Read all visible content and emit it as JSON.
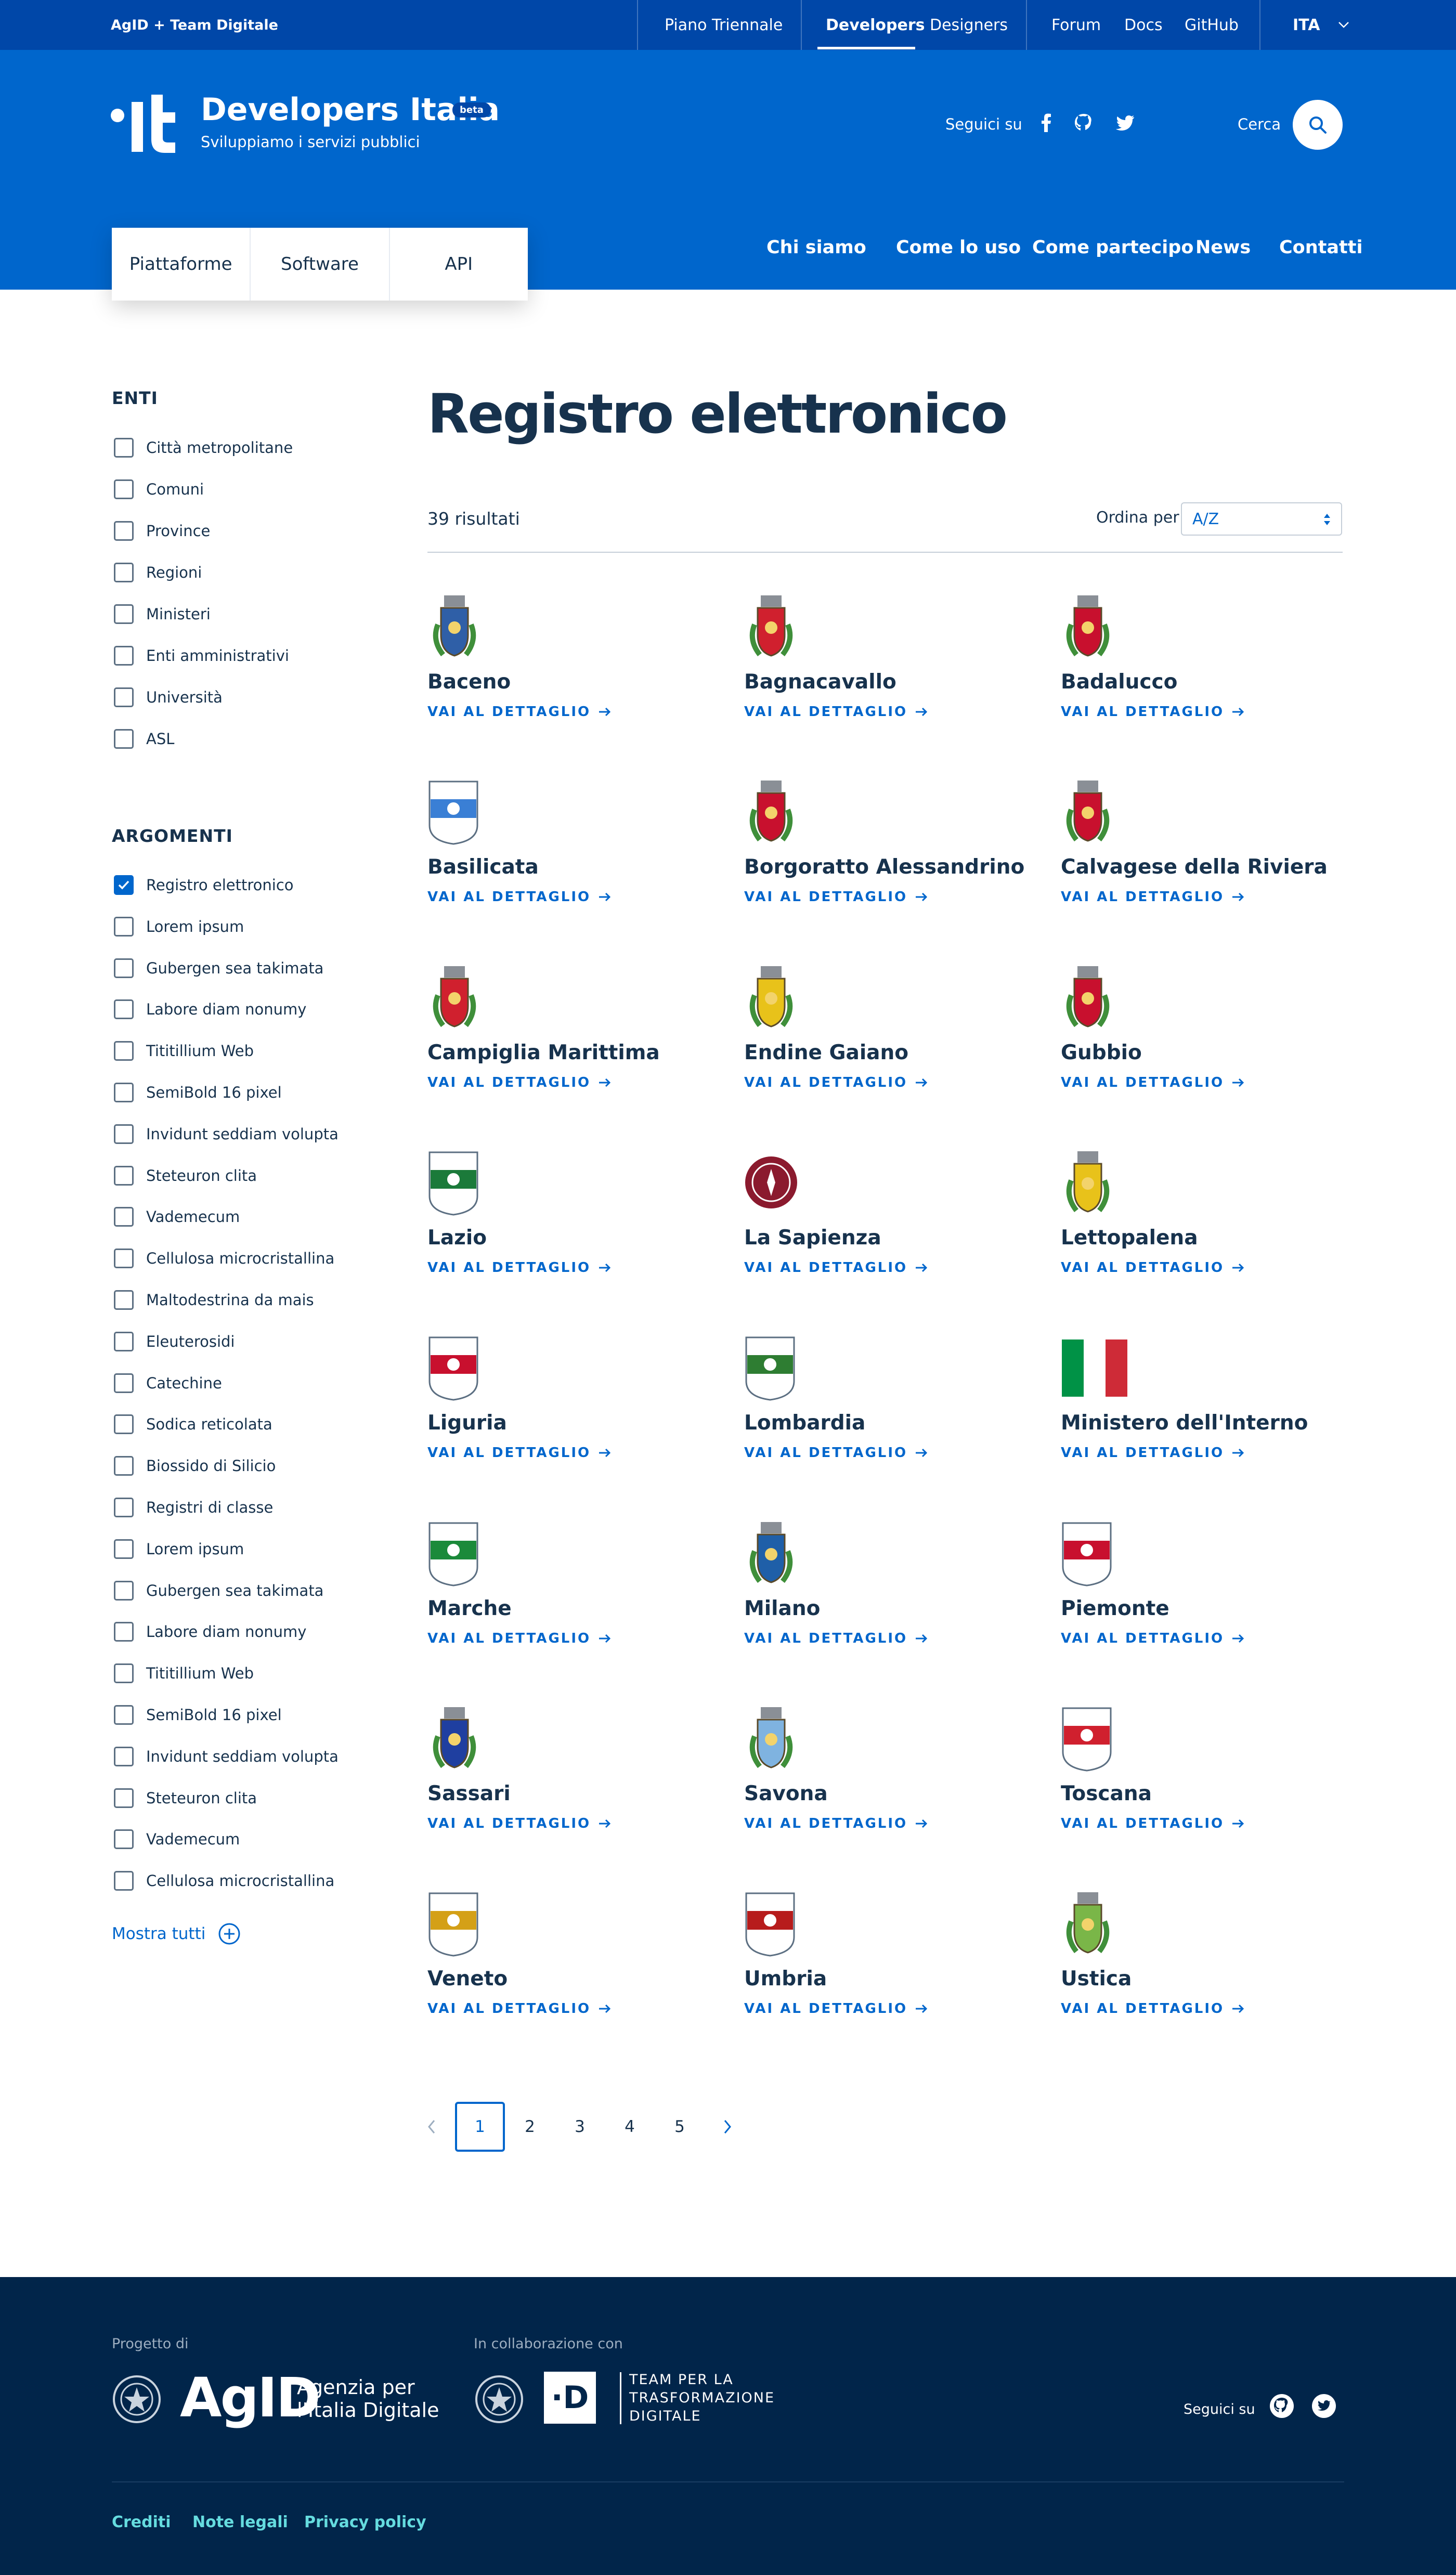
{
  "topbar": {
    "brand": "AgID  +  Team Digitale",
    "links": [
      "Piano Triennale",
      "Developers",
      "Designers",
      "Forum",
      "Docs",
      "GitHub"
    ],
    "lang": "ITA"
  },
  "header": {
    "title": "Developers Italia",
    "beta": "beta",
    "tagline": "Sviluppiamo i servizi pubblici",
    "follow": "Seguici su",
    "search": "Cerca",
    "tabs": [
      "Piattaforme",
      "Software",
      "API"
    ],
    "nav": [
      "Chi siamo",
      "Come lo uso",
      "Come partecipo",
      "News",
      "Contatti"
    ]
  },
  "sidebar": {
    "enti_title": "ENTI",
    "enti": [
      "Città metropolitane",
      "Comuni",
      "Province",
      "Regioni",
      "Ministeri",
      "Enti amministrativi",
      "Università",
      "ASL"
    ],
    "argomenti_title": "ARGOMENTI",
    "argomenti": [
      {
        "label": "Registro elettronico",
        "checked": true
      },
      {
        "label": "Lorem ipsum",
        "checked": false
      },
      {
        "label": "Gubergen sea takimata",
        "checked": false
      },
      {
        "label": "Labore diam nonumy",
        "checked": false
      },
      {
        "label": "Tititillium Web",
        "checked": false
      },
      {
        "label": "SemiBold 16 pixel",
        "checked": false
      },
      {
        "label": "Invidunt seddiam volupta",
        "checked": false
      },
      {
        "label": "Steteuron clita",
        "checked": false
      },
      {
        "label": "Vademecum",
        "checked": false
      },
      {
        "label": "Cellulosa microcristallina",
        "checked": false
      },
      {
        "label": "Maltodestrina da mais",
        "checked": false
      },
      {
        "label": "Eleuterosidi",
        "checked": false
      },
      {
        "label": "Catechine",
        "checked": false
      },
      {
        "label": "Sodica reticolata",
        "checked": false
      },
      {
        "label": "Biossido di Silicio",
        "checked": false
      },
      {
        "label": "Registri di classe",
        "checked": false
      },
      {
        "label": "Lorem ipsum",
        "checked": false
      },
      {
        "label": "Gubergen sea takimata",
        "checked": false
      },
      {
        "label": "Labore diam nonumy",
        "checked": false
      },
      {
        "label": "Tititillium Web",
        "checked": false
      },
      {
        "label": "SemiBold 16 pixel",
        "checked": false
      },
      {
        "label": "Invidunt seddiam volupta",
        "checked": false
      },
      {
        "label": "Steteuron clita",
        "checked": false
      },
      {
        "label": "Vademecum",
        "checked": false
      },
      {
        "label": "Cellulosa microcristallina",
        "checked": false
      }
    ],
    "show_all": "Mostra tutti"
  },
  "main": {
    "title": "Registro elettronico",
    "results": "39 risultati",
    "order_label": "Ordina per",
    "order_value": "A/Z",
    "detail_label": "VAI AL DETTAGLIO",
    "items": [
      {
        "name": "Baceno",
        "icon": "coat-of-arms-icon",
        "color": "#2f5fa7"
      },
      {
        "name": "Bagnacavallo",
        "icon": "coat-of-arms-icon",
        "color": "#d0202e"
      },
      {
        "name": "Badalucco",
        "icon": "coat-of-arms-icon",
        "color": "#c8102e"
      },
      {
        "name": "Basilicata",
        "icon": "regional-shield-icon",
        "color": "#3a7fd5"
      },
      {
        "name": "Borgoratto Alessandrino",
        "icon": "coat-of-arms-icon",
        "color": "#c8102e"
      },
      {
        "name": "Calvagese della Riviera",
        "icon": "coat-of-arms-icon",
        "color": "#c8102e"
      },
      {
        "name": "Campiglia Marittima",
        "icon": "coat-of-arms-icon",
        "color": "#d0202e"
      },
      {
        "name": "Endine Gaiano",
        "icon": "coat-of-arms-icon",
        "color": "#e8c21a"
      },
      {
        "name": "Gubbio",
        "icon": "coat-of-arms-icon",
        "color": "#c8102e"
      },
      {
        "name": "Lazio",
        "icon": "regional-emblem-icon",
        "color": "#1b7a3a"
      },
      {
        "name": "La Sapienza",
        "icon": "university-seal-icon",
        "color": "#8b1a2e"
      },
      {
        "name": "Lettopalena",
        "icon": "coat-of-arms-icon",
        "color": "#e8c21a"
      },
      {
        "name": "Liguria",
        "icon": "regional-emblem-icon",
        "color": "#c8102e"
      },
      {
        "name": "Lombardia",
        "icon": "regional-emblem-icon",
        "color": "#2e7d32"
      },
      {
        "name": "Ministero dell'Interno",
        "icon": "italian-flag-icon",
        "color": "#009246"
      },
      {
        "name": "Marche",
        "icon": "regional-emblem-icon",
        "color": "#1b8a3a"
      },
      {
        "name": "Milano",
        "icon": "coat-of-arms-icon",
        "color": "#1f5fa8"
      },
      {
        "name": "Piemonte",
        "icon": "regional-emblem-icon",
        "color": "#c8102e"
      },
      {
        "name": "Sassari",
        "icon": "coat-of-arms-icon",
        "color": "#1f3fa0"
      },
      {
        "name": "Savona",
        "icon": "coat-of-arms-icon",
        "color": "#7fb3e0"
      },
      {
        "name": "Toscana",
        "icon": "regional-emblem-icon",
        "color": "#d0202e"
      },
      {
        "name": "Veneto",
        "icon": "regional-emblem-icon",
        "color": "#d4a017"
      },
      {
        "name": "Umbria",
        "icon": "regional-emblem-icon",
        "color": "#b71c1c"
      },
      {
        "name": "Ustica",
        "icon": "coat-of-arms-icon",
        "color": "#7ab648"
      }
    ],
    "pagination": [
      "1",
      "2",
      "3",
      "4",
      "5"
    ]
  },
  "footer": {
    "project_of": "Progetto di",
    "agid": "AgID",
    "agid_desc": "Agenzia per\nl'Italia Digitale",
    "collab": "In collaborazione con",
    "team": "TEAM PER LA\nTRASFORMAZIONE\nDIGITALE",
    "follow": "Seguici su",
    "links": [
      "Crediti",
      "Note legali",
      "Privacy policy"
    ]
  },
  "colors": {
    "brand_dark": "#0047a8",
    "brand": "#0066cc",
    "text": "#17324d",
    "footer_bg": "#01254a",
    "footer_link": "#65dcdf"
  }
}
